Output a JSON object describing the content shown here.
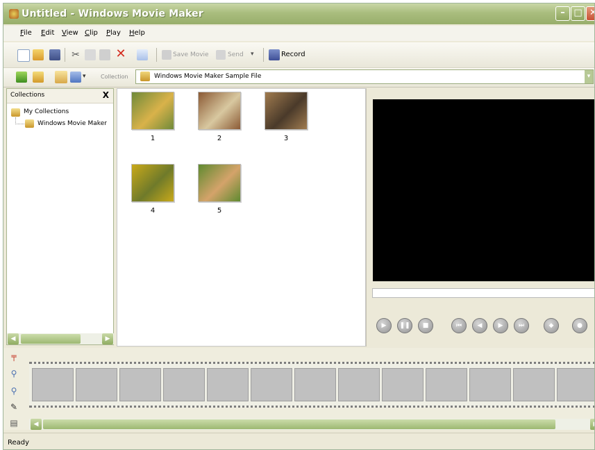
{
  "window": {
    "title": "Untitled - Windows Movie Maker"
  },
  "menu": [
    "File",
    "Edit",
    "View",
    "Clip",
    "Play",
    "Help"
  ],
  "toolbar": {
    "save_movie": "Save Movie",
    "send": "Send",
    "record": "Record"
  },
  "collection_bar": {
    "label": "Collection",
    "value": "Windows Movie Maker Sample File"
  },
  "collections_pane": {
    "title": "Collections",
    "close": "X",
    "tree": [
      {
        "label": "My Collections"
      },
      {
        "label": "Windows Movie Maker"
      }
    ]
  },
  "clips": [
    {
      "label": "1",
      "colors": [
        "#6f8a3a",
        "#d9b24a"
      ]
    },
    {
      "label": "2",
      "colors": [
        "#8b5a35",
        "#d8c8a0"
      ]
    },
    {
      "label": "3",
      "colors": [
        "#a07b4f",
        "#4a3a2a"
      ]
    },
    {
      "label": "4",
      "colors": [
        "#c9a91a",
        "#6f7a2a"
      ]
    },
    {
      "label": "5",
      "colors": [
        "#5f8a30",
        "#d4a36a"
      ]
    }
  ],
  "storyboard": {
    "frame_count": 13
  },
  "status": {
    "text": "Ready"
  }
}
